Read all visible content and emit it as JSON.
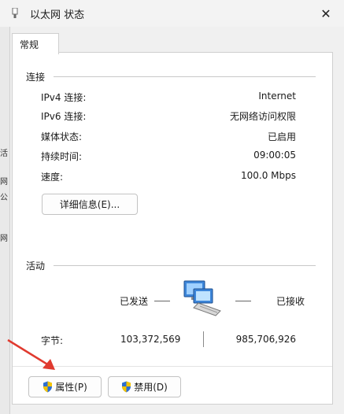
{
  "window": {
    "title": "以太网 状态"
  },
  "tabs": [
    {
      "label": "常规"
    }
  ],
  "connection": {
    "heading": "连接",
    "rows": [
      {
        "label": "IPv4 连接:",
        "value": "Internet"
      },
      {
        "label": "IPv6 连接:",
        "value": "无网络访问权限"
      },
      {
        "label": "媒体状态:",
        "value": "已启用"
      },
      {
        "label": "持续时间:",
        "value": "09:00:05"
      },
      {
        "label": "速度:",
        "value": "100.0 Mbps"
      }
    ],
    "details_button": "详细信息(E)..."
  },
  "activity": {
    "heading": "活动",
    "sent_label": "已发送",
    "received_label": "已接收",
    "bytes_label": "字节:",
    "bytes_sent": "103,372,569",
    "bytes_received": "985,706,926"
  },
  "buttons": {
    "properties": "属性(P)",
    "disable": "禁用(D)"
  },
  "background_fragments": [
    "活",
    "网",
    "公",
    "网"
  ],
  "colors": {
    "accent_arrow": "#e03a2f",
    "shield_blue": "#2e6fd1",
    "shield_yellow": "#f5c400"
  }
}
